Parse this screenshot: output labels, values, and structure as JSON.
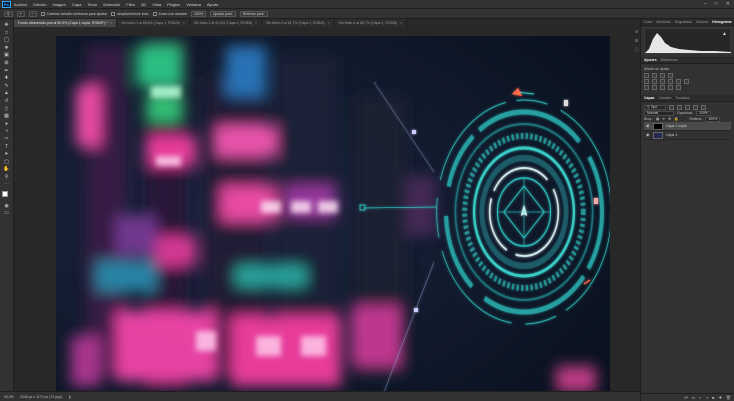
{
  "menubar": {
    "logo": "Ps",
    "items": [
      "Archivo",
      "Edición",
      "Imagen",
      "Capa",
      "Texto",
      "Selección",
      "Filtro",
      "3D",
      "Vista",
      "Plugins",
      "Ventana",
      "Ayuda"
    ]
  },
  "options": {
    "auto_select_label": "Capa",
    "scroll_all": "Cambiar tamaño ventanas para ajustar",
    "zoom_all": "Ampliar/reducir todo",
    "scrubby": "Zoom con arrastre",
    "zoom_level": "100%",
    "fit_screen": "Ajustar pant.",
    "fill_screen": "Rellenar pant."
  },
  "tabs": [
    {
      "label": "Fondo difuminado.psd al 50,9% (Capa 1 copia, RGB/8*) *",
      "active": true
    },
    {
      "label": "Sin título-1 al 66,6% (Capa 1, RGB/8)",
      "active": false
    },
    {
      "label": "Sin título-2 al 42,6% (Capa 1, RGB/8)",
      "active": false
    },
    {
      "label": "Sin título-3 al 54,7% (Capa 1, RGB/8)",
      "active": false
    },
    {
      "label": "Sin título-4 al 66,7% (Capa 1, RGB/8)",
      "active": false
    }
  ],
  "status": {
    "zoom": "50,9%",
    "doc": "2048 px x 1170 px (72 ppp)"
  },
  "panels": {
    "histogram_tabs": [
      "Color",
      "Muestras",
      "Degradado",
      "Motivos",
      "Histograma"
    ],
    "props_tabs": [
      "Ajustes",
      "Bibliotecas"
    ],
    "adjust_label": "Añadir un ajuste",
    "layers_tabs": [
      "Capas",
      "Canales",
      "Trazados"
    ],
    "kind_label": "Tipo",
    "blend_mode": "Normal",
    "opacity_label": "Opacidad:",
    "opacity_value": "100%",
    "lock_label": "Bloq.:",
    "fill_label": "Relleno:",
    "fill_value": "100%",
    "layers": [
      {
        "name": "Capa 1 copia",
        "selected": true
      },
      {
        "name": "Capa 1",
        "selected": false
      }
    ]
  },
  "colors": {
    "accent_teal": "#2ec4c0",
    "accent_pink": "#ff3fa6",
    "panel_bg": "#323232"
  }
}
